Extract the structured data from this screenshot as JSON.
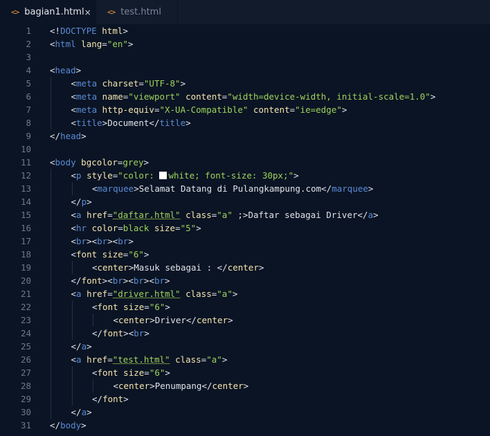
{
  "tabs": [
    {
      "name": "bagian1.html",
      "active": true,
      "close_icon": "×"
    },
    {
      "name": "test.html",
      "active": false
    }
  ],
  "lines": [
    {
      "num": "1",
      "tokens": [
        [
          "p",
          "<!"
        ],
        [
          "t",
          "DOCTYPE "
        ],
        [
          "ht",
          "html"
        ],
        [
          "p",
          ">"
        ]
      ]
    },
    {
      "num": "2",
      "tokens": [
        [
          "p",
          "<"
        ],
        [
          "t",
          "html "
        ],
        [
          "a",
          "lang"
        ],
        [
          "p",
          "="
        ],
        [
          "s",
          "\"en\""
        ],
        [
          "p",
          ">"
        ]
      ]
    },
    {
      "num": "3",
      "tokens": []
    },
    {
      "num": "4",
      "tokens": [
        [
          "p",
          "<"
        ],
        [
          "t",
          "head"
        ],
        [
          "p",
          ">"
        ]
      ]
    },
    {
      "num": "5",
      "indent": 1,
      "tokens": [
        [
          "p",
          "<"
        ],
        [
          "t",
          "meta "
        ],
        [
          "a",
          "charset"
        ],
        [
          "p",
          "="
        ],
        [
          "s",
          "\"UTF-8\""
        ],
        [
          "p",
          ">"
        ]
      ]
    },
    {
      "num": "6",
      "indent": 1,
      "tokens": [
        [
          "p",
          "<"
        ],
        [
          "t",
          "meta "
        ],
        [
          "a",
          "name"
        ],
        [
          "p",
          "="
        ],
        [
          "s",
          "\"viewport\""
        ],
        [
          "x",
          " "
        ],
        [
          "a",
          "content"
        ],
        [
          "p",
          "="
        ],
        [
          "s",
          "\"width=device-width, initial-scale=1.0\""
        ],
        [
          "p",
          ">"
        ]
      ]
    },
    {
      "num": "7",
      "indent": 1,
      "tokens": [
        [
          "p",
          "<"
        ],
        [
          "t",
          "meta "
        ],
        [
          "a",
          "http-equiv"
        ],
        [
          "p",
          "="
        ],
        [
          "s",
          "\"X-UA-Compatible\""
        ],
        [
          "x",
          " "
        ],
        [
          "a",
          "content"
        ],
        [
          "p",
          "="
        ],
        [
          "s",
          "\"ie=edge\""
        ],
        [
          "p",
          ">"
        ]
      ]
    },
    {
      "num": "8",
      "indent": 1,
      "tokens": [
        [
          "p",
          "<"
        ],
        [
          "t",
          "title"
        ],
        [
          "p",
          ">"
        ],
        [
          "x",
          "Document"
        ],
        [
          "p",
          "</"
        ],
        [
          "t",
          "title"
        ],
        [
          "p",
          ">"
        ]
      ]
    },
    {
      "num": "9",
      "tokens": [
        [
          "p",
          "</"
        ],
        [
          "t",
          "head"
        ],
        [
          "p",
          ">"
        ]
      ]
    },
    {
      "num": "10",
      "tokens": []
    },
    {
      "num": "11",
      "tokens": [
        [
          "p",
          "<"
        ],
        [
          "t",
          "body "
        ],
        [
          "a",
          "bgcolor"
        ],
        [
          "p",
          "="
        ],
        [
          "s",
          "grey"
        ],
        [
          "p",
          ">"
        ]
      ]
    },
    {
      "num": "12",
      "indent": 1,
      "tokens": [
        [
          "p",
          "<"
        ],
        [
          "t",
          "p "
        ],
        [
          "a",
          "style"
        ],
        [
          "p",
          "="
        ],
        [
          "s",
          "\"color: "
        ],
        [
          "sw",
          ""
        ],
        [
          "s",
          "white; font-size: 30px;\""
        ],
        [
          "p",
          ">"
        ]
      ]
    },
    {
      "num": "13",
      "indent": 2,
      "tokens": [
        [
          "p",
          "<"
        ],
        [
          "t",
          "marquee"
        ],
        [
          "p",
          ">"
        ],
        [
          "x",
          "Selamat Datang di Pulangkampung.com"
        ],
        [
          "p",
          "</"
        ],
        [
          "t",
          "marquee"
        ],
        [
          "p",
          ">"
        ]
      ]
    },
    {
      "num": "14",
      "indent": 1,
      "tokens": [
        [
          "p",
          "</"
        ],
        [
          "t",
          "p"
        ],
        [
          "p",
          ">"
        ]
      ]
    },
    {
      "num": "15",
      "indent": 1,
      "tokens": [
        [
          "p",
          "<"
        ],
        [
          "t",
          "a "
        ],
        [
          "a",
          "href"
        ],
        [
          "p",
          "="
        ],
        [
          "su",
          "\"daftar.html\""
        ],
        [
          "x",
          " "
        ],
        [
          "a",
          "class"
        ],
        [
          "p",
          "="
        ],
        [
          "s",
          "\"a\""
        ],
        [
          "x",
          " ;"
        ],
        [
          "p",
          ">"
        ],
        [
          "x",
          "Daftar sebagai Driver"
        ],
        [
          "p",
          "</"
        ],
        [
          "t",
          "a"
        ],
        [
          "p",
          ">"
        ]
      ]
    },
    {
      "num": "16",
      "indent": 1,
      "tokens": [
        [
          "p",
          "<"
        ],
        [
          "t",
          "hr "
        ],
        [
          "a",
          "color"
        ],
        [
          "p",
          "="
        ],
        [
          "s",
          "black"
        ],
        [
          "x",
          " "
        ],
        [
          "a",
          "size"
        ],
        [
          "p",
          "="
        ],
        [
          "s",
          "\"5\""
        ],
        [
          "p",
          ">"
        ]
      ]
    },
    {
      "num": "17",
      "indent": 1,
      "tokens": [
        [
          "p",
          "<"
        ],
        [
          "t",
          "br"
        ],
        [
          "p",
          "><"
        ],
        [
          "t",
          "br"
        ],
        [
          "p",
          "><"
        ],
        [
          "t",
          "br"
        ],
        [
          "p",
          ">"
        ]
      ]
    },
    {
      "num": "18",
      "indent": 1,
      "tokens": [
        [
          "p",
          "<"
        ],
        [
          "ft",
          "font "
        ],
        [
          "a",
          "size"
        ],
        [
          "p",
          "="
        ],
        [
          "s",
          "\"6\""
        ],
        [
          "p",
          ">"
        ]
      ]
    },
    {
      "num": "19",
      "indent": 2,
      "tokens": [
        [
          "p",
          "<"
        ],
        [
          "ft",
          "center"
        ],
        [
          "p",
          ">"
        ],
        [
          "x",
          "Masuk sebagai : "
        ],
        [
          "p",
          "</"
        ],
        [
          "ft",
          "center"
        ],
        [
          "p",
          ">"
        ]
      ]
    },
    {
      "num": "20",
      "indent": 1,
      "tokens": [
        [
          "p",
          "</"
        ],
        [
          "ft",
          "font"
        ],
        [
          "p",
          "><"
        ],
        [
          "t",
          "br"
        ],
        [
          "p",
          "><"
        ],
        [
          "t",
          "br"
        ],
        [
          "p",
          "><"
        ],
        [
          "t",
          "br"
        ],
        [
          "p",
          ">"
        ]
      ]
    },
    {
      "num": "21",
      "indent": 1,
      "tokens": [
        [
          "p",
          "<"
        ],
        [
          "t",
          "a "
        ],
        [
          "a",
          "href"
        ],
        [
          "p",
          "="
        ],
        [
          "su",
          "\"driver.html\""
        ],
        [
          "x",
          " "
        ],
        [
          "a",
          "class"
        ],
        [
          "p",
          "="
        ],
        [
          "s",
          "\"a\""
        ],
        [
          "p",
          ">"
        ]
      ]
    },
    {
      "num": "22",
      "indent": 2,
      "tokens": [
        [
          "p",
          "<"
        ],
        [
          "ft",
          "font "
        ],
        [
          "a",
          "size"
        ],
        [
          "p",
          "="
        ],
        [
          "s",
          "\"6\""
        ],
        [
          "p",
          ">"
        ]
      ]
    },
    {
      "num": "23",
      "indent": 3,
      "tokens": [
        [
          "p",
          "<"
        ],
        [
          "ft",
          "center"
        ],
        [
          "p",
          ">"
        ],
        [
          "x",
          "Driver"
        ],
        [
          "p",
          "</"
        ],
        [
          "ft",
          "center"
        ],
        [
          "p",
          ">"
        ]
      ]
    },
    {
      "num": "24",
      "indent": 2,
      "tokens": [
        [
          "p",
          "</"
        ],
        [
          "ft",
          "font"
        ],
        [
          "p",
          "><"
        ],
        [
          "t",
          "br"
        ],
        [
          "p",
          ">"
        ]
      ]
    },
    {
      "num": "25",
      "indent": 1,
      "tokens": [
        [
          "p",
          "</"
        ],
        [
          "t",
          "a"
        ],
        [
          "p",
          ">"
        ]
      ]
    },
    {
      "num": "26",
      "indent": 1,
      "tokens": [
        [
          "p",
          "<"
        ],
        [
          "t",
          "a "
        ],
        [
          "a",
          "href"
        ],
        [
          "p",
          "="
        ],
        [
          "su",
          "\"test.html\""
        ],
        [
          "x",
          " "
        ],
        [
          "a",
          "class"
        ],
        [
          "p",
          "="
        ],
        [
          "s",
          "\"a\""
        ],
        [
          "p",
          ">"
        ]
      ]
    },
    {
      "num": "27",
      "indent": 2,
      "tokens": [
        [
          "p",
          "<"
        ],
        [
          "ft",
          "font "
        ],
        [
          "a",
          "size"
        ],
        [
          "p",
          "="
        ],
        [
          "s",
          "\"6\""
        ],
        [
          "p",
          ">"
        ]
      ]
    },
    {
      "num": "28",
      "indent": 3,
      "tokens": [
        [
          "p",
          "<"
        ],
        [
          "ft",
          "center"
        ],
        [
          "p",
          ">"
        ],
        [
          "x",
          "Penumpang"
        ],
        [
          "p",
          "</"
        ],
        [
          "ft",
          "center"
        ],
        [
          "p",
          ">"
        ]
      ]
    },
    {
      "num": "29",
      "indent": 2,
      "tokens": [
        [
          "p",
          "</"
        ],
        [
          "ft",
          "font"
        ],
        [
          "p",
          ">"
        ]
      ]
    },
    {
      "num": "30",
      "indent": 1,
      "tokens": [
        [
          "p",
          "</"
        ],
        [
          "t",
          "a"
        ],
        [
          "p",
          ">"
        ]
      ]
    },
    {
      "num": "31",
      "tokens": [
        [
          "p",
          "</"
        ],
        [
          "t",
          "body"
        ],
        [
          "p",
          ">"
        ]
      ]
    }
  ]
}
